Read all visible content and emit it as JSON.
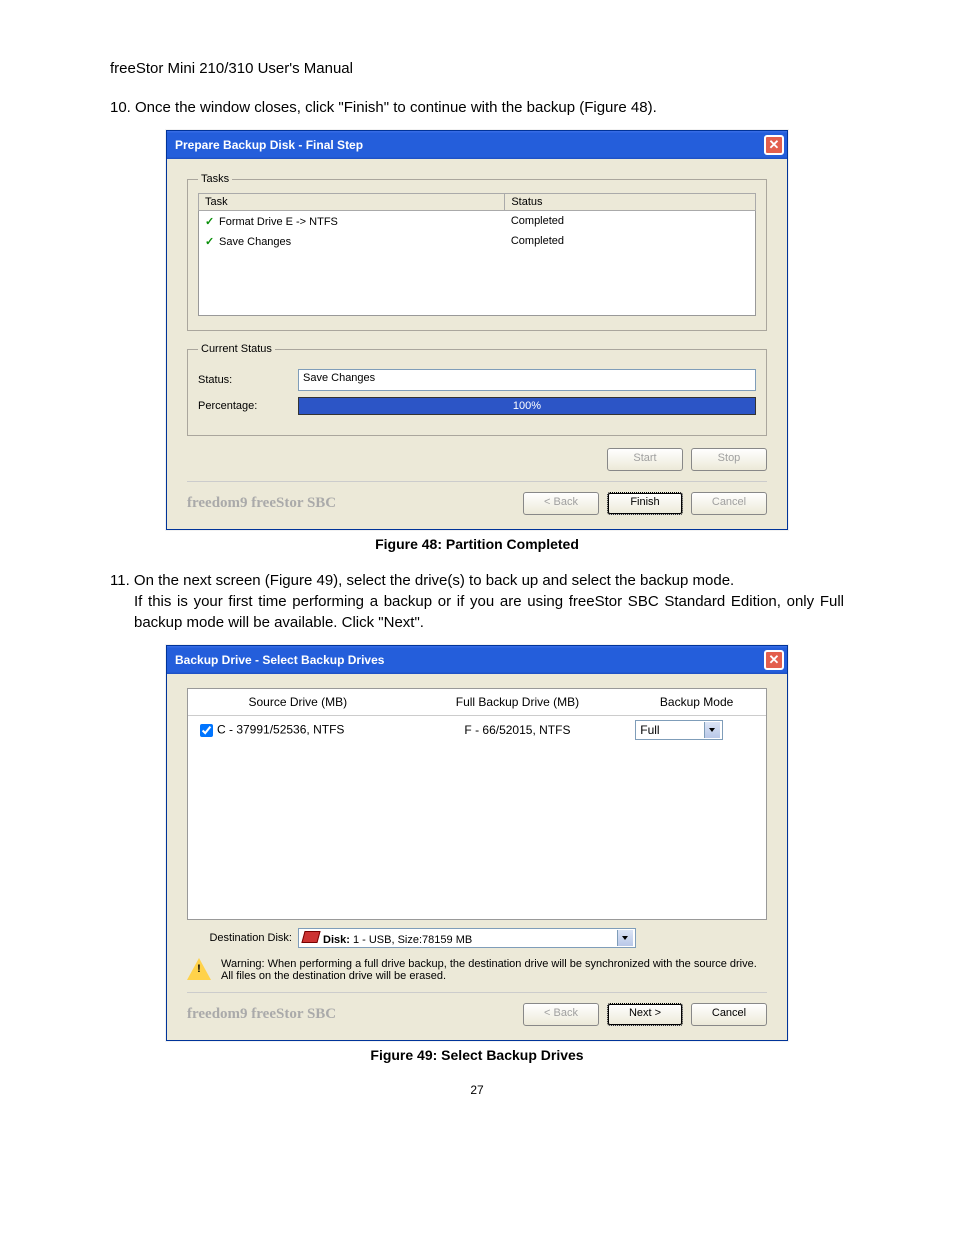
{
  "header": "freeStor Mini 210/310 User's Manual",
  "step10": "10. Once the window closes, click \"Finish\" to continue with the backup (Figure 48).",
  "figure48_caption": "Figure 48: Partition Completed",
  "step11_line1": "11. On the next screen (Figure 49), select the drive(s) to back up and select the backup mode.",
  "step11_line2": "If this is your first time performing a backup or if you are using freeStor SBC Standard Edition, only Full backup mode will be available.  Click \"Next\".",
  "figure49_caption": "Figure 49: Select Backup Drives",
  "page_number": "27",
  "dialog1": {
    "title": "Prepare Backup Disk - Final Step",
    "tasks_legend": "Tasks",
    "col_task": "Task",
    "col_status": "Status",
    "rows": [
      {
        "task": "Format Drive E -> NTFS",
        "status": "Completed"
      },
      {
        "task": "Save Changes",
        "status": "Completed"
      }
    ],
    "current_status_legend": "Current Status",
    "status_label": "Status:",
    "status_value": "Save Changes",
    "percentage_label": "Percentage:",
    "percentage_value": "100%",
    "start_btn": "Start",
    "stop_btn": "Stop",
    "back_btn": "< Back",
    "finish_btn": "Finish",
    "cancel_btn": "Cancel",
    "brand": "freedom9 freeStor SBC"
  },
  "dialog2": {
    "title": "Backup Drive - Select Backup Drives",
    "col_source": "Source Drive (MB)",
    "col_full": "Full Backup Drive (MB)",
    "col_mode": "Backup Mode",
    "row": {
      "source": "C - 37991/52536, NTFS",
      "full": "F - 66/52015, NTFS",
      "mode": "Full"
    },
    "dest_label": "Destination Disk:",
    "dest_value": "Disk: 1 - USB, Size:78159 MB",
    "warning": "Warning: When performing a full drive backup, the destination drive will be synchronized with the source drive. All files on the destination drive will be erased.",
    "back_btn": "< Back",
    "next_btn": "Next >",
    "cancel_btn": "Cancel",
    "brand": "freedom9 freeStor SBC"
  }
}
